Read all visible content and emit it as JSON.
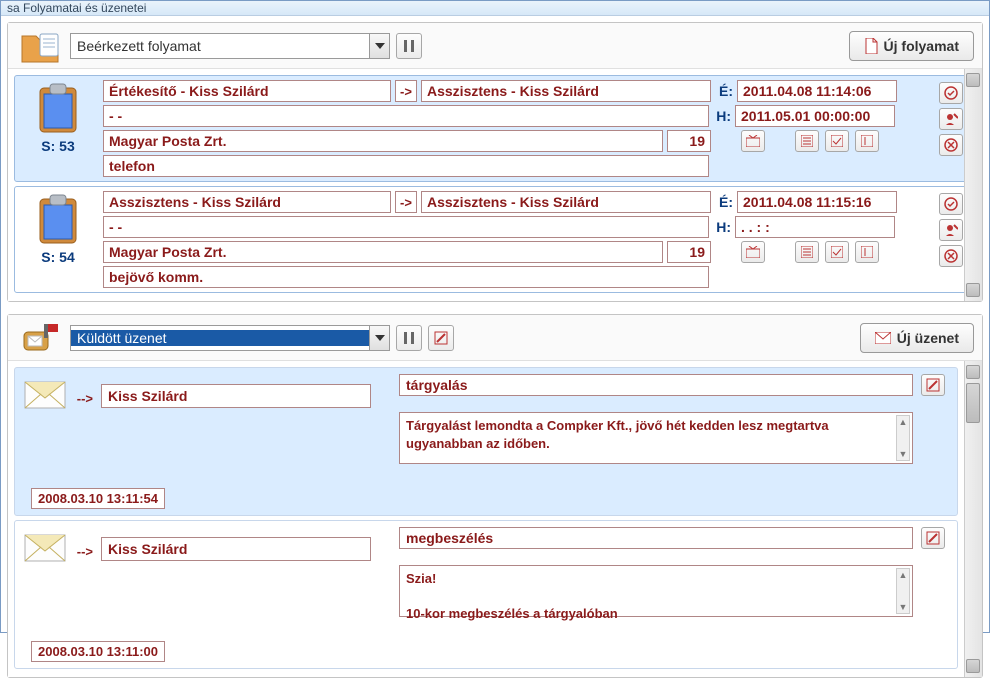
{
  "window": {
    "title": "sa Folyamatai és üzenetei"
  },
  "processes": {
    "combo": "Beérkezett folyamat",
    "new_button": "Új folyamat",
    "items": [
      {
        "sid": "S: 53",
        "from": "Értékesítő - Kiss Szilárd",
        "to": "Asszisztens - Kiss Szilárd",
        "line2": "- -",
        "partner": "Magyar Posta Zrt.",
        "qty": "19",
        "note": "telefon",
        "e_label": "É:",
        "e_date": "2011.04.08 11:14:06",
        "h_label": "H:",
        "h_date": "2011.05.01 00:00:00",
        "selected": true
      },
      {
        "sid": "S: 54",
        "from": "Asszisztens - Kiss Szilárd",
        "to": "Asszisztens - Kiss Szilárd",
        "line2": "- -",
        "partner": "Magyar Posta Zrt.",
        "qty": "19",
        "note": "bejövő komm.",
        "e_label": "É:",
        "e_date": "2011.04.08 11:15:16",
        "h_label": "H:",
        "h_date": ". .   : :",
        "selected": false
      }
    ]
  },
  "messages": {
    "combo": "Küldött üzenet",
    "new_button": "Új üzenet",
    "items": [
      {
        "arrow": "-->",
        "recipient": "Kiss Szilárd",
        "timestamp": "2008.03.10 13:11:54",
        "subject": "tárgyalás",
        "body": "Tárgyalást lemondta a Compker Kft., jövő hét kedden lesz megtartva ugyanabban az időben.",
        "selected": true
      },
      {
        "arrow": "-->",
        "recipient": "Kiss Szilárd",
        "timestamp": "2008.03.10 13:11:00",
        "subject": "megbeszélés",
        "body": "Szia!\n\n10-kor megbeszélés a tárgyalóban",
        "selected": false
      }
    ]
  }
}
